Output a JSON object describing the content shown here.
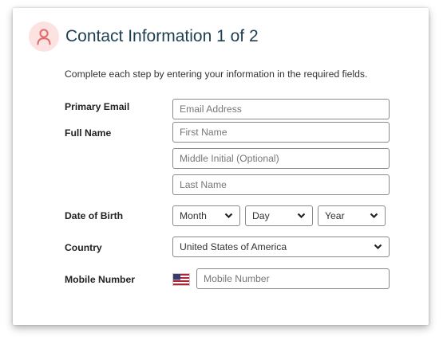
{
  "header": {
    "title": "Contact Information 1 of 2",
    "subtitle": "Complete each step by entering your information in the required fields."
  },
  "form": {
    "primary_email": {
      "label": "Primary Email",
      "placeholder": "Email Address",
      "value": ""
    },
    "full_name": {
      "label": "Full Name",
      "first_placeholder": "First Name",
      "middle_placeholder": "Middle Initial (Optional)",
      "last_placeholder": "Last Name"
    },
    "date_of_birth": {
      "label": "Date of Birth",
      "month": "Month",
      "day": "Day",
      "year": "Year"
    },
    "country": {
      "label": "Country",
      "selected": "United States of America"
    },
    "mobile_number": {
      "label": "Mobile Number",
      "placeholder": "Mobile Number",
      "flag_icon": "us-flag-icon"
    }
  },
  "colors": {
    "accent": "#e26a6a",
    "icon_bg": "#fde2e2",
    "title": "#1d3f52",
    "border": "#8a8a8a"
  }
}
